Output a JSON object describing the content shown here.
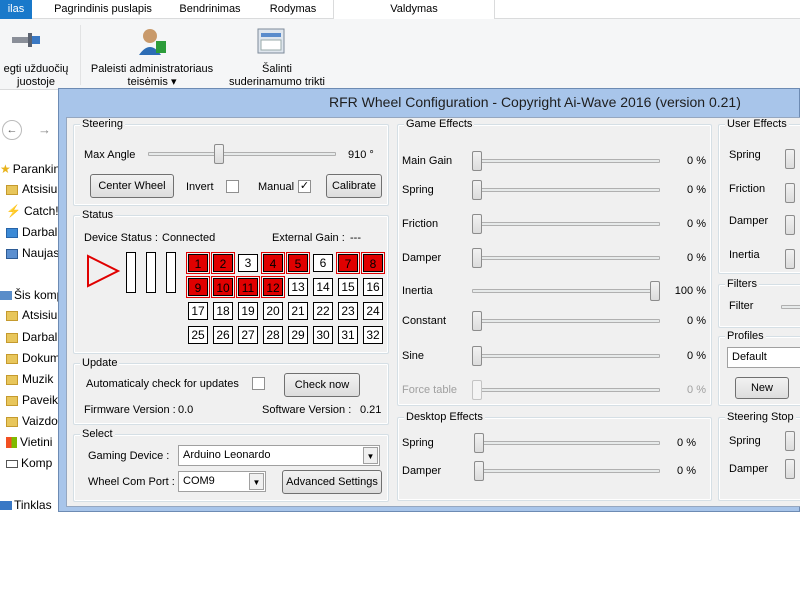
{
  "explorer": {
    "tabs": [
      "ilas",
      "Pagrindinis puslapis",
      "Bendrinimas",
      "Rodymas",
      "Valdymas"
    ],
    "ribbon_pin_line1": "egti užduočių",
    "ribbon_pin_line2": "juostoje",
    "ribbon_admin_line1": "Paleisti administratoriaus",
    "ribbon_admin_line2": "teisėmis",
    "ribbon_admin_arrow": "▾",
    "ribbon_compat_line1": "Šalinti",
    "ribbon_compat_line2": "suderinamumo trikti",
    "nav_back": "←",
    "nav_forward": "→",
    "nav": [
      "Parankin",
      "Atsisiu",
      "Catch!",
      "Darbal",
      "Naujas",
      "Šis komp",
      "Atsisiu",
      "Darbal",
      "Dokum",
      "Muzik",
      "Paveik",
      "Vaizdo",
      "Vietini",
      "Komp",
      "Tinklas"
    ]
  },
  "dialog": {
    "title": "RFR Wheel Configuration - Copyright Ai-Wave 2016 (version 0.21)",
    "steering": {
      "title": "Steering",
      "max_angle_label": "Max Angle",
      "max_angle_value": "910 °",
      "max_angle_fraction": 0.37,
      "center_button": "Center Wheel",
      "invert_label": "Invert",
      "invert_checked": false,
      "manual_label": "Manual",
      "manual_checked": true,
      "check_mark": "✓",
      "calibrate_button": "Calibrate"
    },
    "status": {
      "title": "Status",
      "device_status_label": "Device Status :",
      "device_status_value": "Connected",
      "external_gain_label": "External Gain :",
      "external_gain_value": "---",
      "buttons": [
        "1",
        "2",
        "3",
        "4",
        "5",
        "6",
        "7",
        "8",
        "9",
        "10",
        "11",
        "12",
        "13",
        "14",
        "15",
        "16",
        "17",
        "18",
        "19",
        "20",
        "21",
        "22",
        "23",
        "24",
        "25",
        "26",
        "27",
        "28",
        "29",
        "30",
        "31",
        "32"
      ],
      "pressed": [
        1,
        2,
        4,
        5,
        7,
        8,
        9,
        10,
        11,
        12
      ]
    },
    "update": {
      "title": "Update",
      "auto_check_label": "Automaticaly check for updates",
      "auto_check_checked": false,
      "check_now_button": "Check now",
      "firmware_label": "Firmware Version :",
      "firmware_value": "0.0",
      "software_label": "Software Version :",
      "software_value": "0.21"
    },
    "select": {
      "title": "Select",
      "gaming_device_label": "Gaming Device :",
      "gaming_device_value": "Arduino Leonardo",
      "com_port_label": "Wheel Com Port :",
      "com_port_value": "COM9",
      "advanced_button": "Advanced Settings",
      "dropdown_arrow": "▼"
    },
    "game_effects": {
      "title": "Game Effects",
      "items": [
        {
          "label": "Main Gain",
          "value": "0 %",
          "fraction": 0.0,
          "enabled": true
        },
        {
          "label": "Spring",
          "value": "0 %",
          "fraction": 0.0,
          "enabled": true
        },
        {
          "label": "Friction",
          "value": "0 %",
          "fraction": 0.0,
          "enabled": true
        },
        {
          "label": "Damper",
          "value": "0 %",
          "fraction": 0.0,
          "enabled": true
        },
        {
          "label": "Inertia",
          "value": "100 %",
          "fraction": 1.0,
          "enabled": true
        },
        {
          "label": "Constant",
          "value": "0 %",
          "fraction": 0.0,
          "enabled": true
        },
        {
          "label": "Sine",
          "value": "0 %",
          "fraction": 0.0,
          "enabled": true
        },
        {
          "label": "Force table",
          "value": "0 %",
          "fraction": 0.0,
          "enabled": false
        }
      ]
    },
    "desktop_effects": {
      "title": "Desktop Effects",
      "items": [
        {
          "label": "Spring",
          "value": "0 %",
          "fraction": 0.0
        },
        {
          "label": "Damper",
          "value": "0 %",
          "fraction": 0.0
        }
      ]
    },
    "user_effects": {
      "title": "User Effects",
      "items": [
        "Spring",
        "Friction",
        "Damper",
        "Inertia"
      ]
    },
    "filters": {
      "title": "Filters",
      "filter_label": "Filter"
    },
    "profiles": {
      "title": "Profiles",
      "selected": "Default",
      "new_button": "New"
    },
    "steering_stop": {
      "title": "Steering Stop",
      "items": [
        "Spring",
        "Damper"
      ]
    }
  }
}
